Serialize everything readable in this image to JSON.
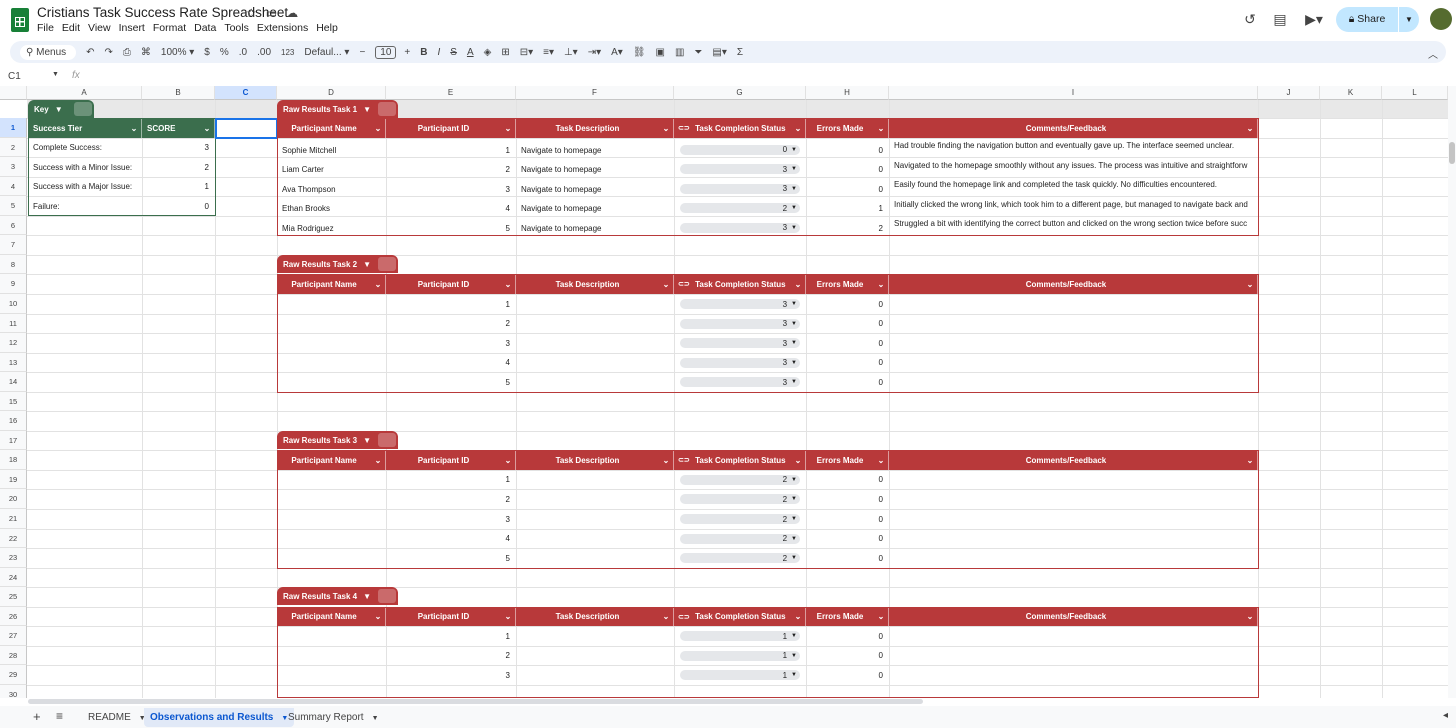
{
  "app": {
    "doc_title": "Cristians Task Success Rate Spreadsheet",
    "menu": [
      "File",
      "Edit",
      "View",
      "Insert",
      "Format",
      "Data",
      "Tools",
      "Extensions",
      "Help"
    ],
    "share_label": "Share"
  },
  "toolbar": {
    "menus_label": "Menus",
    "zoom": "100%",
    "currency": "$",
    "percent": "%",
    "dec_decrease": ".0",
    "dec_increase": ".00",
    "number_format": "123",
    "font": "Defaul...",
    "font_size": "10"
  },
  "formula_bar": {
    "cell_ref": "C1",
    "fx": "fx"
  },
  "columns": [
    "A",
    "B",
    "C",
    "D",
    "E",
    "F",
    "G",
    "H",
    "I",
    "J",
    "K",
    "L"
  ],
  "key_table": {
    "chip_label": "Key",
    "headers": [
      "Success Tier",
      "SCORE"
    ],
    "rows": [
      {
        "tier": "Complete Success:",
        "score": "3"
      },
      {
        "tier": "Success with a Minor Issue:",
        "score": "2"
      },
      {
        "tier": "Success with a Major Issue:",
        "score": "1"
      },
      {
        "tier": "Failure:",
        "score": "0"
      }
    ]
  },
  "result_headers": [
    "Participant Name",
    "Participant ID",
    "Task Description",
    "Task Completion Status",
    "Errors Made",
    "Comments/Feedback"
  ],
  "tasks": [
    {
      "label": "Raw Results Task 1",
      "rows": [
        {
          "name": "Sophie Mitchell",
          "id": "1",
          "desc": "Navigate to homepage",
          "status": "0",
          "errors": "0",
          "comment": "Had trouble finding the navigation button and eventually gave up. The interface seemed unclear."
        },
        {
          "name": "Liam Carter",
          "id": "2",
          "desc": "Navigate to homepage",
          "status": "3",
          "errors": "0",
          "comment": "Navigated to the homepage smoothly without any issues. The process was intuitive and straightforw"
        },
        {
          "name": "Ava Thompson",
          "id": "3",
          "desc": "Navigate to homepage",
          "status": "3",
          "errors": "0",
          "comment": "Easily found the homepage link and completed the task quickly. No difficulties encountered."
        },
        {
          "name": "Ethan Brooks",
          "id": "4",
          "desc": "Navigate to homepage",
          "status": "2",
          "errors": "1",
          "comment": "Initially clicked the wrong link, which took him to a different page, but managed to navigate back and"
        },
        {
          "name": "Mia Rodriguez",
          "id": "5",
          "desc": "Navigate to homepage",
          "status": "3",
          "errors": "2",
          "comment": "Struggled a bit with identifying the correct button and clicked on the wrong section twice before succ"
        }
      ]
    },
    {
      "label": "Raw Results Task 2",
      "rows": [
        {
          "name": "",
          "id": "1",
          "desc": "",
          "status": "3",
          "errors": "0",
          "comment": ""
        },
        {
          "name": "",
          "id": "2",
          "desc": "",
          "status": "3",
          "errors": "0",
          "comment": ""
        },
        {
          "name": "",
          "id": "3",
          "desc": "",
          "status": "3",
          "errors": "0",
          "comment": ""
        },
        {
          "name": "",
          "id": "4",
          "desc": "",
          "status": "3",
          "errors": "0",
          "comment": ""
        },
        {
          "name": "",
          "id": "5",
          "desc": "",
          "status": "3",
          "errors": "0",
          "comment": ""
        }
      ]
    },
    {
      "label": "Raw Results Task 3",
      "rows": [
        {
          "name": "",
          "id": "1",
          "desc": "",
          "status": "2",
          "errors": "0",
          "comment": ""
        },
        {
          "name": "",
          "id": "2",
          "desc": "",
          "status": "2",
          "errors": "0",
          "comment": ""
        },
        {
          "name": "",
          "id": "3",
          "desc": "",
          "status": "2",
          "errors": "0",
          "comment": ""
        },
        {
          "name": "",
          "id": "4",
          "desc": "",
          "status": "2",
          "errors": "0",
          "comment": ""
        },
        {
          "name": "",
          "id": "5",
          "desc": "",
          "status": "2",
          "errors": "0",
          "comment": ""
        }
      ]
    },
    {
      "label": "Raw Results Task 4",
      "rows": [
        {
          "name": "",
          "id": "1",
          "desc": "",
          "status": "1",
          "errors": "0",
          "comment": ""
        },
        {
          "name": "",
          "id": "2",
          "desc": "",
          "status": "1",
          "errors": "0",
          "comment": ""
        },
        {
          "name": "",
          "id": "3",
          "desc": "",
          "status": "1",
          "errors": "0",
          "comment": ""
        }
      ]
    }
  ],
  "sheets": [
    {
      "label": "README",
      "active": false
    },
    {
      "label": "Observations and Results",
      "active": true
    },
    {
      "label": "Summary Report",
      "active": false
    }
  ],
  "colors": {
    "key_green": "#3b6e4d",
    "task_red": "#b8393a"
  }
}
